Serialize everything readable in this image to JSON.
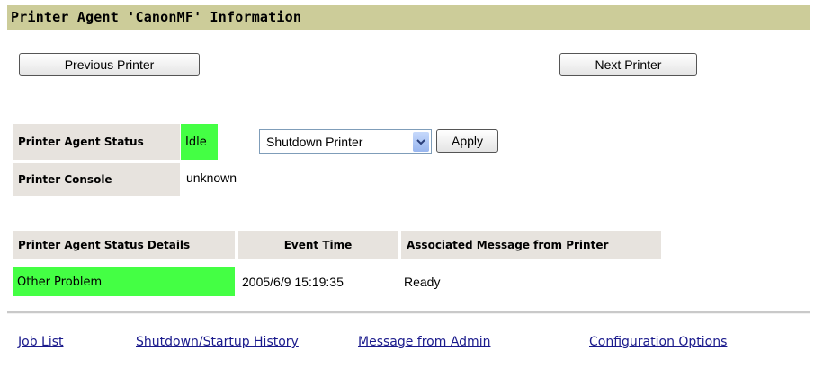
{
  "header": {
    "title": "Printer Agent 'CanonMF' Information"
  },
  "navigation": {
    "previous_label": "Previous Printer",
    "next_label": "Next Printer"
  },
  "status": {
    "agent_status_label": "Printer Agent Status",
    "agent_status_value": "Idle",
    "agent_status_color": "#44ff44",
    "action_select": {
      "selected": "Shutdown Printer",
      "icon": "chevron-down-icon"
    },
    "apply_label": "Apply",
    "console_label": "Printer Console",
    "console_value": "unknown"
  },
  "details_table": {
    "headers": [
      "Printer Agent Status Details",
      "Event Time",
      "Associated Message from Printer"
    ],
    "rows": [
      {
        "details": "Other Problem",
        "event_time": "2005/6/9 15:19:35",
        "message": "Ready",
        "status_color": "#44ff44"
      }
    ]
  },
  "links": [
    "Job List",
    "Shutdown/Startup History",
    "Message from Admin",
    "Configuration Options"
  ],
  "colors": {
    "title_bar": "#cccc99",
    "label_cell": "#e7e3de",
    "link": "#1a1a8c"
  }
}
